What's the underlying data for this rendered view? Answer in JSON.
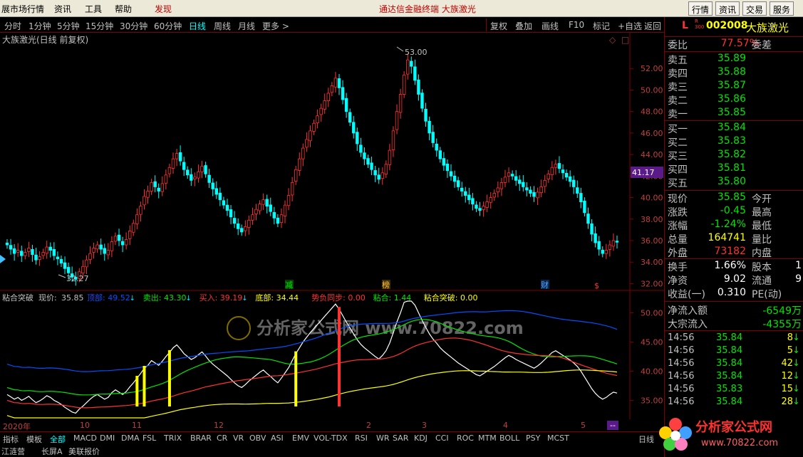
{
  "menubar": {
    "items": [
      "展市场行情",
      "资讯",
      "工具",
      "帮助"
    ],
    "highlight": "发现",
    "center_title": "通达信金融终端    大族激光",
    "right_buttons": [
      "行情",
      "资讯",
      "交易",
      "服务"
    ]
  },
  "toolbar": {
    "periods": [
      "分时",
      "1分钟",
      "5分钟",
      "15分钟",
      "30分钟",
      "60分钟",
      "日线",
      "周线",
      "月线",
      "更多 >"
    ],
    "active": "日线",
    "right_items": [
      "复权",
      "叠加",
      "画线",
      "F10",
      "标记",
      "+自选",
      "返回"
    ]
  },
  "chart_header": {
    "title": "大族激光(日线 前复权)"
  },
  "main_chart": {
    "y_labels": [
      "52.00",
      "50.00",
      "48.00",
      "46.00",
      "44.00",
      "42.00",
      "40.00",
      "38.00",
      "36.00",
      "34.00",
      "32.00"
    ],
    "current_price_tag": "41.17",
    "high_marker": "53.00",
    "low_marker": "32.27",
    "event_markers": [
      "减",
      "榜",
      "财",
      "$"
    ]
  },
  "indicator": {
    "name": "粘合突破",
    "now_label": "现价:",
    "now_value": "35.85",
    "items": [
      {
        "label": "顶部:",
        "value": "49.52",
        "color": "#0050ff"
      },
      {
        "label": "卖出:",
        "value": "43.30",
        "color": "#00e600"
      },
      {
        "label": "买入:",
        "value": "39.19",
        "color": "#ff3232"
      },
      {
        "label": "底部:",
        "value": "34.44",
        "color": "#ffff00"
      },
      {
        "label": "势负同步:",
        "value": "0.00",
        "color": "#ff3232"
      },
      {
        "label": "粘合:",
        "value": "1.44",
        "color": "#00e600"
      },
      {
        "label": "粘合突破:",
        "value": "0.00",
        "color": "#ffff00"
      }
    ],
    "y_labels": [
      "50.00",
      "45.00",
      "40.00",
      "35.00"
    ],
    "watermark": "分析家公式网 www.70822.com"
  },
  "x_axis": {
    "labels": [
      "2020年",
      "10",
      "11",
      "12",
      "2",
      "3",
      "4",
      "5"
    ],
    "right_tag": "--"
  },
  "bottom_tabs": {
    "items": [
      "指标",
      "模板",
      "全部",
      "MACD",
      "DMI",
      "DMA",
      "FSL",
      "TRIX",
      "BRAR",
      "CR",
      "VR",
      "OBV",
      "ASI",
      "EMV",
      "VOL-TDX",
      "RSI",
      "WR",
      "SAR",
      "KDJ",
      "CCI",
      "ROC",
      "MTM",
      "BOLL",
      "PSY",
      "MCST"
    ],
    "right_label": "日线"
  },
  "status_bar": {
    "items": [
      "江涟营",
      "长屏A",
      "美联报价"
    ]
  },
  "quote_panel": {
    "flag": "L",
    "flag_sub": "R\n300",
    "code": "002008",
    "name": "大族激光",
    "weibi_label": "委比",
    "weibi_value": "77.57%",
    "weicha_label": "委差",
    "sells": [
      {
        "label": "卖五",
        "price": "35.89"
      },
      {
        "label": "卖四",
        "price": "35.88"
      },
      {
        "label": "卖三",
        "price": "35.87"
      },
      {
        "label": "卖二",
        "price": "35.86"
      },
      {
        "label": "卖一",
        "price": "35.85"
      }
    ],
    "buys": [
      {
        "label": "买一",
        "price": "35.84"
      },
      {
        "label": "买二",
        "price": "35.83"
      },
      {
        "label": "买三",
        "price": "35.82"
      },
      {
        "label": "买四",
        "price": "35.81"
      },
      {
        "label": "买五",
        "price": "35.80"
      }
    ],
    "stats": [
      {
        "k": "现价",
        "v": "35.85",
        "vc": "green",
        "k2": "今开"
      },
      {
        "k": "涨跌",
        "v": "-0.45",
        "vc": "green",
        "k2": "最高"
      },
      {
        "k": "涨幅",
        "v": "-1.24%",
        "vc": "green",
        "k2": "最低"
      },
      {
        "k": "总量",
        "v": "164741",
        "vc": "yellow",
        "k2": "量比"
      },
      {
        "k": "外盘",
        "v": "73182",
        "vc": "red",
        "k2": "内盘"
      }
    ],
    "stats2": [
      {
        "k": "换手",
        "v": "1.66%",
        "vc": "white",
        "k2": "股本",
        "v2": "1"
      },
      {
        "k": "净资",
        "v": "9.02",
        "vc": "white",
        "k2": "流通",
        "v2": "9"
      },
      {
        "k": "收益(一)",
        "v": "0.310",
        "vc": "white",
        "k2": "PE(动)",
        "v2": ""
      }
    ],
    "flows": [
      {
        "k": "净流入额",
        "v": "-6549万"
      },
      {
        "k": "大宗流入",
        "v": "-4355万"
      }
    ],
    "ticks": [
      {
        "t": "14:56",
        "p": "35.84",
        "n": "8"
      },
      {
        "t": "14:56",
        "p": "35.84",
        "n": "5"
      },
      {
        "t": "14:56",
        "p": "35.84",
        "n": "42"
      },
      {
        "t": "14:56",
        "p": "35.84",
        "n": "12"
      },
      {
        "t": "14:56",
        "p": "35.83",
        "n": "15"
      },
      {
        "t": "14:56",
        "p": "35.84",
        "n": "28"
      }
    ]
  },
  "logo": {
    "text": "分析家公式网",
    "url": "www.70822.com"
  },
  "chart_data": {
    "type": "candlestick",
    "ylim": [
      31.5,
      54
    ],
    "closes": [
      35.6,
      35.2,
      34.8,
      35.1,
      34.6,
      34.9,
      35.3,
      34.7,
      34.2,
      34.5,
      34.9,
      35.4,
      35.1,
      34.6,
      34.3,
      33.9,
      33.4,
      33.0,
      32.6,
      32.4,
      33.1,
      33.6,
      34.2,
      34.8,
      35.3,
      35.6,
      35.2,
      34.8,
      35.1,
      35.9,
      36.4,
      36.0,
      35.6,
      36.1,
      36.9,
      37.6,
      38.4,
      39.2,
      40.1,
      40.6,
      41.4,
      41.0,
      40.6,
      41.3,
      42.1,
      42.8,
      43.6,
      44.1,
      43.4,
      42.6,
      42.1,
      41.6,
      41.9,
      42.4,
      42.9,
      42.2,
      41.4,
      40.8,
      40.3,
      39.8,
      39.3,
      38.8,
      38.2,
      37.6,
      37.1,
      36.8,
      37.3,
      37.9,
      38.4,
      38.9,
      39.4,
      39.8,
      39.2,
      38.7,
      38.1,
      37.6,
      38.4,
      39.3,
      40.2,
      41.4,
      42.6,
      43.6,
      44.6,
      45.4,
      46.2,
      46.9,
      47.6,
      48.3,
      49.0,
      49.7,
      50.4,
      51.1,
      50.2,
      49.1,
      48.0,
      47.0,
      46.0,
      45.0,
      44.2,
      43.6,
      43.1,
      42.6,
      42.1,
      41.7,
      42.3,
      43.1,
      44.4,
      46.2,
      48.0,
      49.6,
      51.4,
      52.8,
      52.2,
      50.9,
      49.6,
      48.3,
      47.1,
      46.0,
      45.1,
      44.4,
      43.6,
      43.0,
      42.5,
      42.0,
      41.5,
      41.0,
      40.6,
      40.2,
      39.8,
      39.4,
      39.0,
      38.8,
      39.2,
      39.6,
      40.0,
      40.4,
      40.9,
      41.4,
      41.9,
      42.3,
      42.0,
      41.6,
      41.3,
      41.0,
      40.7,
      40.4,
      40.1,
      40.5,
      41.0,
      41.6,
      42.2,
      42.8,
      43.1,
      42.7,
      42.3,
      41.9,
      41.5,
      41.0,
      40.4,
      39.6,
      38.6,
      37.6,
      36.6,
      35.8,
      35.2,
      34.8,
      35.1,
      35.6,
      36.0,
      35.85
    ]
  }
}
